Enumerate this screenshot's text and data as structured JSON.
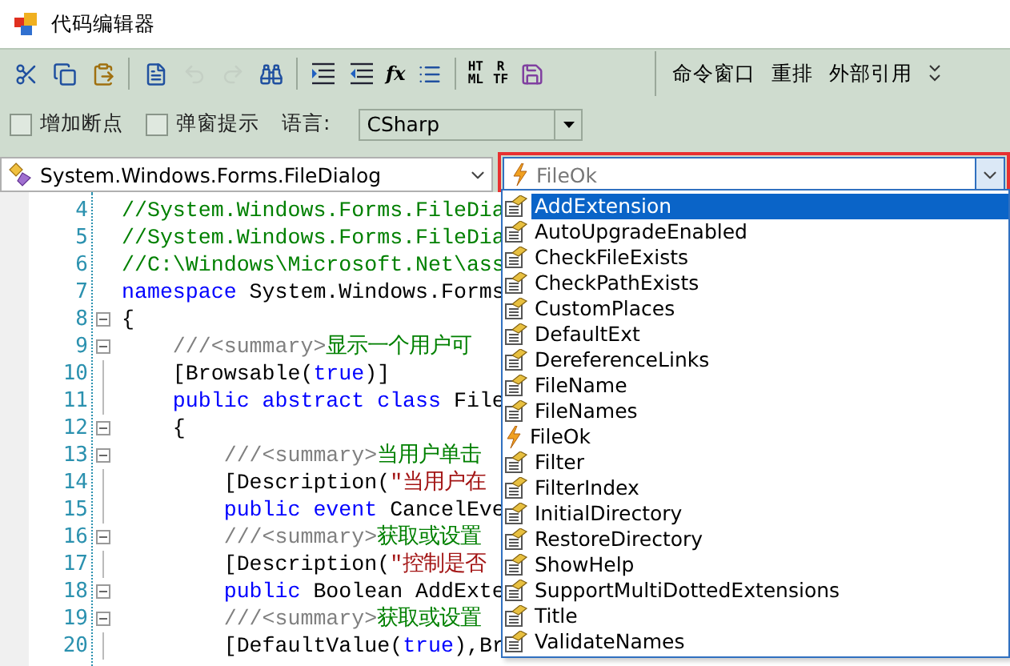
{
  "window": {
    "title": "代码编辑器"
  },
  "toolbar": {
    "items": [
      {
        "kind": "icon",
        "disabled": false
      },
      {
        "kind": "icon",
        "disabled": false
      },
      {
        "kind": "icon",
        "disabled": false
      },
      {
        "kind": "separator"
      },
      {
        "kind": "icon",
        "disabled": false
      },
      {
        "kind": "icon",
        "disabled": true
      },
      {
        "kind": "icon",
        "disabled": true
      },
      {
        "kind": "icon",
        "disabled": false
      },
      {
        "kind": "separator"
      },
      {
        "kind": "icon",
        "disabled": false
      },
      {
        "kind": "icon",
        "disabled": false
      },
      {
        "kind": "text",
        "label": "fx"
      },
      {
        "kind": "icon",
        "disabled": false
      },
      {
        "kind": "separator"
      },
      {
        "kind": "stack",
        "lines": [
          "HT",
          "ML"
        ]
      },
      {
        "kind": "stack",
        "lines": [
          "R",
          "TF"
        ]
      },
      {
        "kind": "icon",
        "disabled": false
      }
    ],
    "commands": [
      "命令窗口",
      "重排",
      "外部引用"
    ]
  },
  "options": {
    "checkboxes": [
      {
        "label": "增加断点",
        "checked": false
      },
      {
        "label": "弹窗提示",
        "checked": false
      }
    ],
    "language_label": "语言:",
    "language": "CSharp"
  },
  "class_combo": {
    "value": "System.Windows.Forms.FileDialog"
  },
  "member_combo": {
    "value": "FileOk",
    "highlighted": true
  },
  "code": [
    {
      "number": "4",
      "fold": false,
      "segments": [
        {
          "kind": "comment",
          "text": "//System.Windows.Forms.FileDia"
        }
      ]
    },
    {
      "number": "5",
      "fold": false,
      "segments": [
        {
          "kind": "comment",
          "text": "//System.Windows.Forms.FileDia"
        }
      ]
    },
    {
      "number": "6",
      "fold": false,
      "segments": [
        {
          "kind": "comment",
          "text": "//C:\\Windows\\Microsoft.Net\\ass"
        }
      ]
    },
    {
      "number": "7",
      "fold": false,
      "segments": [
        {
          "kind": "keyword",
          "text": "namespace"
        },
        {
          "kind": "plain",
          "text": " System.Windows.Forms"
        }
      ]
    },
    {
      "number": "8",
      "fold": true,
      "segments": [
        {
          "kind": "plain",
          "text": "{"
        }
      ]
    },
    {
      "number": "9",
      "fold": true,
      "segments": [
        {
          "kind": "doc",
          "text": "    ///<summary>"
        },
        {
          "kind": "comment",
          "text": "显示一个用户可"
        }
      ]
    },
    {
      "number": "10",
      "fold": false,
      "segments": [
        {
          "kind": "plain",
          "text": "    [Browsable("
        },
        {
          "kind": "keyword",
          "text": "true"
        },
        {
          "kind": "plain",
          "text": ")]"
        }
      ]
    },
    {
      "number": "11",
      "fold": false,
      "segments": [
        {
          "kind": "keyword",
          "text": "    public abstract class"
        },
        {
          "kind": "plain",
          "text": " File"
        }
      ]
    },
    {
      "number": "12",
      "fold": true,
      "segments": [
        {
          "kind": "plain",
          "text": "    {"
        }
      ]
    },
    {
      "number": "13",
      "fold": true,
      "segments": [
        {
          "kind": "doc",
          "text": "        ///<summary>"
        },
        {
          "kind": "comment",
          "text": "当用户单击"
        }
      ]
    },
    {
      "number": "14",
      "fold": false,
      "segments": [
        {
          "kind": "plain",
          "text": "        [Description("
        },
        {
          "kind": "string",
          "text": "\"当用户在"
        }
      ]
    },
    {
      "number": "15",
      "fold": false,
      "segments": [
        {
          "kind": "keyword",
          "text": "        public event"
        },
        {
          "kind": "plain",
          "text": " CancelEve"
        }
      ]
    },
    {
      "number": "16",
      "fold": true,
      "segments": [
        {
          "kind": "doc",
          "text": "        ///<summary>"
        },
        {
          "kind": "comment",
          "text": "获取或设置"
        }
      ]
    },
    {
      "number": "17",
      "fold": false,
      "segments": [
        {
          "kind": "plain",
          "text": "        [Description("
        },
        {
          "kind": "string",
          "text": "\"控制是否"
        }
      ]
    },
    {
      "number": "18",
      "fold": true,
      "segments": [
        {
          "kind": "keyword",
          "text": "        public"
        },
        {
          "kind": "plain",
          "text": " Boolean AddExte"
        }
      ]
    },
    {
      "number": "19",
      "fold": true,
      "segments": [
        {
          "kind": "doc",
          "text": "        ///<summary>"
        },
        {
          "kind": "comment",
          "text": "获取或设置"
        }
      ]
    },
    {
      "number": "20",
      "fold": false,
      "segments": [
        {
          "kind": "plain",
          "text": "        [DefaultValue("
        },
        {
          "kind": "keyword",
          "text": "true"
        },
        {
          "kind": "plain",
          "text": "),Br"
        }
      ]
    }
  ],
  "member_list": [
    {
      "label": "AddExtension",
      "kind": "property",
      "selected": true
    },
    {
      "label": "AutoUpgradeEnabled",
      "kind": "property",
      "selected": false
    },
    {
      "label": "CheckFileExists",
      "kind": "property",
      "selected": false
    },
    {
      "label": "CheckPathExists",
      "kind": "property",
      "selected": false
    },
    {
      "label": "CustomPlaces",
      "kind": "property",
      "selected": false
    },
    {
      "label": "DefaultExt",
      "kind": "property",
      "selected": false
    },
    {
      "label": "DereferenceLinks",
      "kind": "property",
      "selected": false
    },
    {
      "label": "FileName",
      "kind": "property",
      "selected": false
    },
    {
      "label": "FileNames",
      "kind": "property",
      "selected": false
    },
    {
      "label": "FileOk",
      "kind": "event",
      "selected": false
    },
    {
      "label": "Filter",
      "kind": "property",
      "selected": false
    },
    {
      "label": "FilterIndex",
      "kind": "property",
      "selected": false
    },
    {
      "label": "InitialDirectory",
      "kind": "property",
      "selected": false
    },
    {
      "label": "RestoreDirectory",
      "kind": "property",
      "selected": false
    },
    {
      "label": "ShowHelp",
      "kind": "property",
      "selected": false
    },
    {
      "label": "SupportMultiDottedExtensions",
      "kind": "property",
      "selected": false
    },
    {
      "label": "Title",
      "kind": "property",
      "selected": false
    },
    {
      "label": "ValidateNames",
      "kind": "property",
      "selected": false
    }
  ]
}
